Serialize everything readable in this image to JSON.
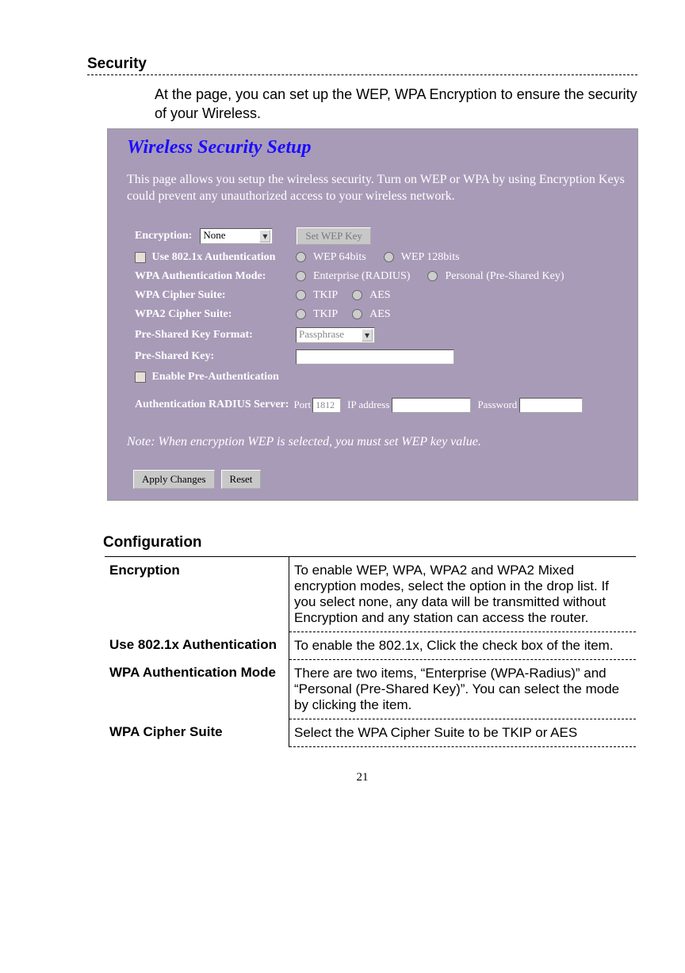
{
  "section_heading": "Security",
  "intro": "At the page, you can set up the WEP, WPA Encryption to ensure the security of your Wireless.",
  "screenshot": {
    "title": "Wireless Security Setup",
    "desc": "This page allows you setup the wireless security. Turn on WEP or WPA by using Encryption Keys could prevent any unauthorized access to your wireless network.",
    "encryption_label": "Encryption:",
    "encryption_value": "None",
    "set_wep_btn": "Set WEP Key",
    "use_8021x_label": "Use 802.1x Authentication",
    "wep64_label": "WEP 64bits",
    "wep128_label": "WEP 128bits",
    "wpa_auth_mode_label": "WPA Authentication Mode:",
    "enterprise_label": "Enterprise (RADIUS)",
    "personal_label": "Personal (Pre-Shared Key)",
    "wpa_cipher_label": "WPA Cipher Suite:",
    "wpa2_cipher_label": "WPA2 Cipher Suite:",
    "tkip_label": "TKIP",
    "aes_label": "AES",
    "psk_format_label": "Pre-Shared Key Format:",
    "psk_format_value": "Passphrase",
    "psk_label": "Pre-Shared Key:",
    "enable_preauth_label": "Enable Pre-Authentication",
    "radius_label": "Authentication RADIUS Server:",
    "port_label": "Port",
    "port_value": "1812",
    "ip_label": "IP address",
    "password_label": "Password",
    "note": "Note: When encryption WEP is selected, you must set WEP key value.",
    "apply_btn": "Apply Changes",
    "reset_btn": "Reset"
  },
  "config_heading": "Configuration",
  "config_rows": [
    {
      "name": "Encryption",
      "desc": "To enable WEP, WPA, WPA2 and WPA2 Mixed encryption modes, select the option in the drop list. If you select none, any data will be transmitted without Encryption and any station can access the router."
    },
    {
      "name": "Use 802.1x Authentication",
      "desc": "To enable the 802.1x, Click the check box of the item."
    },
    {
      "name": "WPA Authentication Mode",
      "desc": "There are two items, “Enterprise (WPA-Radius)” and “Personal (Pre-Shared Key)”. You can select the mode by clicking the item."
    },
    {
      "name": "WPA Cipher Suite",
      "desc": "Select the WPA Cipher Suite to be TKIP or AES"
    }
  ],
  "page_number": "21"
}
